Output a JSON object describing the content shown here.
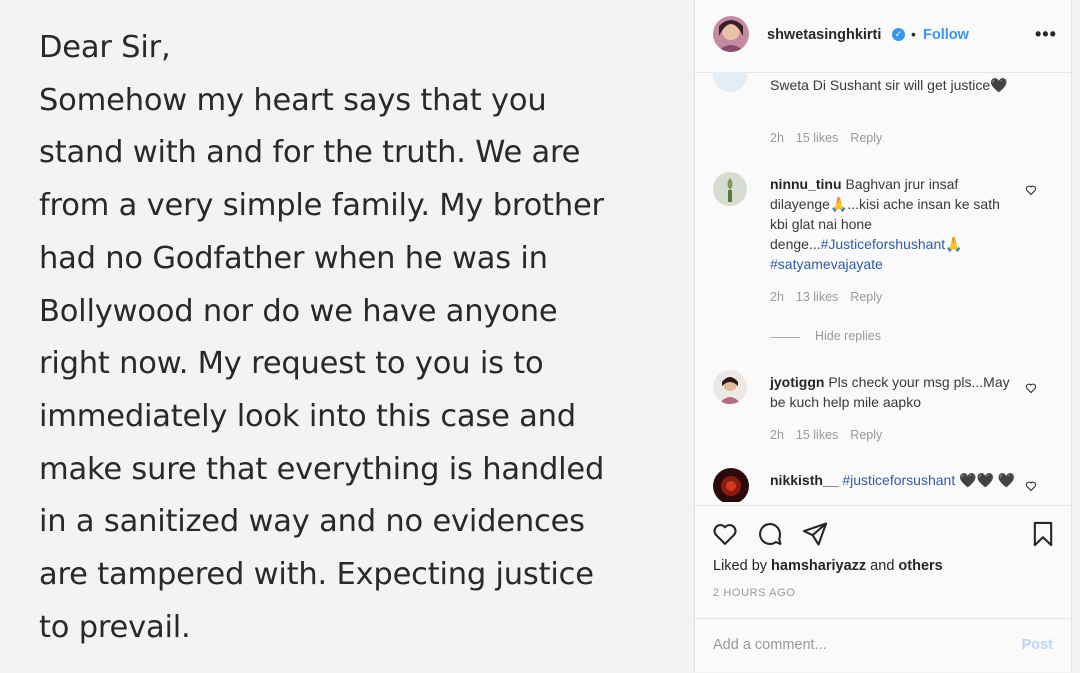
{
  "post": {
    "note_lines": [
      "Dear Sir,",
      "Somehow my heart says that you",
      "stand with and for the truth. We are",
      "from a very simple family. My brother",
      "had no Godfather when he was in",
      "Bollywood nor do we have anyone",
      "right now. My request to you is to",
      "immediately look into this case and",
      "make sure that everything is handled",
      "in a sanitized way and no evidences",
      "are tampered with.  Expecting justice",
      "to prevail."
    ]
  },
  "header": {
    "username": "shwetasinghkirti",
    "separator": "•",
    "follow_label": "Follow",
    "more_label": "•••"
  },
  "comments": [
    {
      "username": "",
      "text": "Sweta Di Sushant sir will get justice🖤",
      "time": "2h",
      "likes": "15 likes",
      "reply": "Reply"
    },
    {
      "username": "ninnu_tinu",
      "text_parts": [
        "Baghvan jrur insaf dilayenge🙏...kisi ache insan ke sath kbi glat nai hone denge...",
        "#Justiceforshushant",
        "🙏 ",
        "#satyamevajayate"
      ],
      "time": "2h",
      "likes": "13 likes",
      "reply": "Reply",
      "hide_replies": "Hide replies"
    },
    {
      "username": "jyotiggn",
      "text": "Pls check your msg pls...May be kuch help mile aapko",
      "time": "2h",
      "likes": "15 likes",
      "reply": "Reply"
    },
    {
      "username": "nikkisth__",
      "hashtag": "#justiceforsushant",
      "suffix": " 🖤🖤 🖤"
    }
  ],
  "actions": {
    "liked_prefix": "Liked by ",
    "liked_user": "hamshariyazz",
    "liked_middle": " and ",
    "liked_others": "others",
    "timestamp": "2 HOURS AGO"
  },
  "comment_box": {
    "placeholder": "Add a comment...",
    "post_label": "Post"
  },
  "colors": {
    "link_blue": "#3897f0",
    "hashtag_blue": "#2d5ca8",
    "muted": "#9a9898"
  },
  "icons": [
    "verified-badge-icon",
    "heart-icon",
    "comment-icon",
    "share-icon",
    "bookmark-icon",
    "more-icon"
  ]
}
